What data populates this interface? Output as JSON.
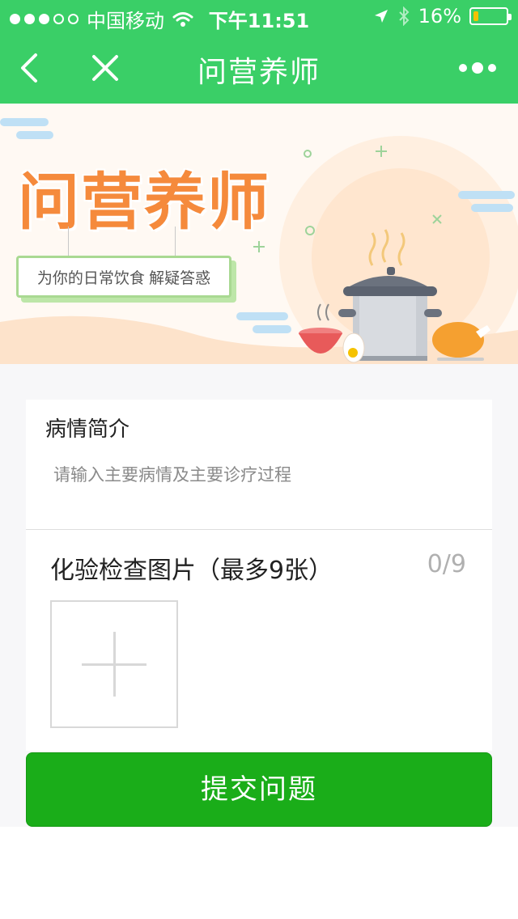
{
  "status_bar": {
    "carrier": "中国移动",
    "time": "下午11:51",
    "battery_percent": "16%",
    "battery_level": 0.16
  },
  "nav": {
    "title": "问营养师",
    "icons": [
      "back-chevron-icon",
      "close-icon",
      "more-dots-icon"
    ]
  },
  "banner": {
    "headline": "问营养师",
    "tagline": "为你的日常饮食 解疑答惑"
  },
  "form": {
    "description_label": "病情简介",
    "description_placeholder": "请输入主要病情及主要诊疗过程",
    "images_label": "化验检查图片（最多9张）",
    "images_count": "0/9"
  },
  "submit_label": "提交问题",
  "colors": {
    "nav_green": "#3ACF67",
    "button_green": "#1AAD19",
    "headline_orange": "#F58A3C"
  }
}
